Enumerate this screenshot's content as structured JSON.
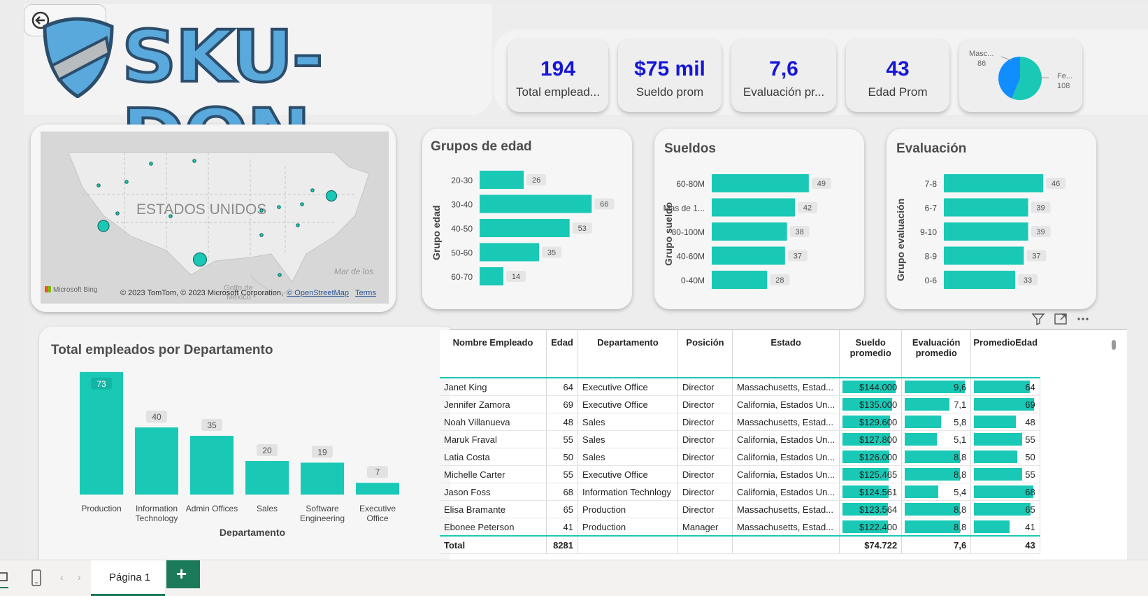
{
  "logo": {
    "text": "SKU-DON"
  },
  "kpis": [
    {
      "value": "194",
      "label": "Total emplead..."
    },
    {
      "value": "$75 mil",
      "label": "Sueldo prom"
    },
    {
      "value": "7,6",
      "label": "Evaluación pr..."
    },
    {
      "value": "43",
      "label": "Edad Prom"
    }
  ],
  "gender_pie": {
    "masc_label": "Masc...",
    "masc_value": "86",
    "fem_label": "Fe...",
    "fem_value": "108",
    "colors": {
      "masc": "#118dff",
      "fem": "#19c9b6"
    }
  },
  "map": {
    "country_label": "ESTADOS UNIDOS",
    "water_label": "Mar de los",
    "gulf_label": "Golfo de",
    "gulf_label2": "México",
    "bing": "Microsoft Bing",
    "attribution": "© 2023 TomTom, © 2023 Microsoft Corporation,",
    "osm": "© OpenStreetMap",
    "terms": "Terms"
  },
  "charts_titles": {
    "age": "Grupos de edad",
    "age_axis": "Grupo edad",
    "salary": "Sueldos",
    "salary_axis": "Grupo sueldo",
    "eval": "Evaluación",
    "eval_axis": "Grupo evaluación",
    "dept": "Total empleados por Departamento",
    "dept_axis": "Departamento"
  },
  "chart_data": [
    {
      "type": "bar",
      "title": "Grupos de edad",
      "ylabel": "Grupo edad",
      "orientation": "horizontal",
      "categories": [
        "20-30",
        "30-40",
        "40-50",
        "50-60",
        "60-70"
      ],
      "values": [
        26,
        66,
        53,
        35,
        14
      ],
      "xlim": [
        0,
        70
      ]
    },
    {
      "type": "bar",
      "title": "Sueldos",
      "ylabel": "Grupo sueldo",
      "orientation": "horizontal",
      "categories": [
        "60-80M",
        "Mas de 1...",
        "80-100M",
        "40-60M",
        "0-40M"
      ],
      "values": [
        49,
        42,
        38,
        37,
        28
      ],
      "xlim": [
        0,
        60
      ]
    },
    {
      "type": "bar",
      "title": "Evaluación",
      "ylabel": "Grupo evaluación",
      "orientation": "horizontal",
      "categories": [
        "7-8",
        "6-7",
        "9-10",
        "8-9",
        "0-6"
      ],
      "values": [
        46,
        39,
        39,
        37,
        33
      ],
      "xlim": [
        0,
        55
      ]
    },
    {
      "type": "bar",
      "title": "Total empleados por Departamento",
      "xlabel": "Departamento",
      "orientation": "vertical",
      "categories": [
        "Production",
        "Information Technology",
        "Admin Offices",
        "Sales",
        "Software Engineering",
        "Executive Office"
      ],
      "category_lines": [
        [
          "Production"
        ],
        [
          "Information",
          "Technology"
        ],
        [
          "Admin Offices"
        ],
        [
          "Sales"
        ],
        [
          "Software",
          "Engineering"
        ],
        [
          "Executive",
          "Office"
        ]
      ],
      "values": [
        73,
        40,
        35,
        20,
        19,
        7
      ],
      "ylim": [
        0,
        75
      ]
    }
  ],
  "table": {
    "headers": [
      "Nombre Empleado",
      "Edad",
      "Departamento",
      "Posición",
      "Estado",
      "Sueldo promedio",
      "Evaluación promedio",
      "PromedioEdad"
    ],
    "rows": [
      {
        "name": "Janet King",
        "age": "64",
        "dept": "Executive Office",
        "pos": "Director",
        "state": "Massachusetts, Estad...",
        "salary": "$144.000",
        "sal_frac": 1.0,
        "eval": "9,6",
        "eval_frac": 1.0,
        "avg_age": "64",
        "age_frac": 0.93
      },
      {
        "name": "Jennifer Zamora",
        "age": "69",
        "dept": "Executive Office",
        "pos": "Director",
        "state": "California, Estados Un...",
        "salary": "$135.000",
        "sal_frac": 0.94,
        "eval": "7,1",
        "eval_frac": 0.74,
        "avg_age": "69",
        "age_frac": 1.0
      },
      {
        "name": "Noah Villanueva",
        "age": "48",
        "dept": "Sales",
        "pos": "Director",
        "state": "Massachusetts, Estad...",
        "salary": "$129.600",
        "sal_frac": 0.9,
        "eval": "5,8",
        "eval_frac": 0.6,
        "avg_age": "48",
        "age_frac": 0.7
      },
      {
        "name": "Maruk Fraval",
        "age": "55",
        "dept": "Sales",
        "pos": "Director",
        "state": "California, Estados Un...",
        "salary": "$127.800",
        "sal_frac": 0.89,
        "eval": "5,1",
        "eval_frac": 0.53,
        "avg_age": "55",
        "age_frac": 0.8
      },
      {
        "name": "Latia Costa",
        "age": "50",
        "dept": "Sales",
        "pos": "Director",
        "state": "California, Estados Un...",
        "salary": "$126.000",
        "sal_frac": 0.875,
        "eval": "8,8",
        "eval_frac": 0.92,
        "avg_age": "50",
        "age_frac": 0.72
      },
      {
        "name": "Michelle Carter",
        "age": "55",
        "dept": "Executive Office",
        "pos": "Director",
        "state": "California, Estados Un...",
        "salary": "$125.465",
        "sal_frac": 0.87,
        "eval": "8,8",
        "eval_frac": 0.92,
        "avg_age": "55",
        "age_frac": 0.8
      },
      {
        "name": "Jason Foss",
        "age": "68",
        "dept": "Information Technlogy",
        "pos": "Director",
        "state": "California, Estados Un...",
        "salary": "$124.561",
        "sal_frac": 0.865,
        "eval": "5,4",
        "eval_frac": 0.56,
        "avg_age": "68",
        "age_frac": 0.99
      },
      {
        "name": "Elisa Bramante",
        "age": "65",
        "dept": "Production",
        "pos": "Director",
        "state": "Massachusetts, Estad...",
        "salary": "$123.564",
        "sal_frac": 0.86,
        "eval": "8,8",
        "eval_frac": 0.92,
        "avg_age": "65",
        "age_frac": 0.94
      },
      {
        "name": "Ebonee Peterson",
        "age": "41",
        "dept": "Production",
        "pos": "Manager",
        "state": "Massachusetts, Estad...",
        "salary": "$122.400",
        "sal_frac": 0.85,
        "eval": "8,8",
        "eval_frac": 0.92,
        "avg_age": "41",
        "age_frac": 0.59
      }
    ],
    "total": {
      "label": "Total",
      "age": "8281",
      "salary": "$74.722",
      "eval": "7,6",
      "avg_age": "43"
    }
  },
  "tabs": {
    "page1": "Página 1",
    "add": "+"
  },
  "colors": {
    "teal": "#19c9b6",
    "kpi_value": "#1616d6",
    "add_tab": "#1b7a59"
  }
}
